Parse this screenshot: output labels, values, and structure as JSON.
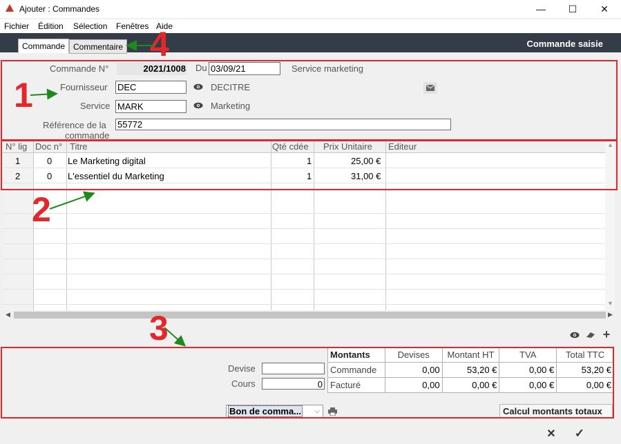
{
  "window": {
    "title": "Ajouter : Commandes",
    "minimize": "—",
    "maximize": "☐",
    "close": "✕"
  },
  "menu": [
    "Fichier",
    "Édition",
    "Sélection",
    "Fenêtres",
    "Aide"
  ],
  "tabs": [
    {
      "label": "Commande",
      "active": true
    },
    {
      "label": "Commentaire",
      "active": false
    }
  ],
  "status": "Commande saisie",
  "form": {
    "order_label": "Commande N°",
    "order_number": "2021/1008",
    "date_label": "Du",
    "date": "03/09/21",
    "service_text": "Service marketing",
    "supplier_label": "Fournisseur",
    "supplier_code": "DEC",
    "supplier_name": "DECITRE",
    "service_label": "Service",
    "service_code": "MARK",
    "service_name": "Marketing",
    "reference_label_1": "Référence de la",
    "reference_label_2": "commande",
    "reference": "55772"
  },
  "annotations": {
    "n1": "1",
    "n2": "2",
    "n3": "3",
    "n4": "4"
  },
  "grid": {
    "columns": [
      "N° lig",
      "Doc n°",
      "Titre",
      "Qté cdée",
      "Prix Unitaire",
      "Editeur"
    ],
    "rows": [
      [
        "1",
        "0",
        "Le Marketing digital",
        "1",
        "25,00 €",
        ""
      ],
      [
        "2",
        "0",
        "L'essentiel du Marketing",
        "1",
        "31,00 €",
        ""
      ]
    ]
  },
  "currency": {
    "devise_label": "Devise",
    "devise_value": "",
    "cours_label": "Cours",
    "cours_value": "0"
  },
  "amounts": {
    "headers": [
      "Montants",
      "Devises",
      "Montant HT",
      "TVA",
      "Total TTC"
    ],
    "rows": [
      [
        "Commande",
        "0,00",
        "53,20 €",
        "0,00 €",
        "53,20 €"
      ],
      [
        "Facturé",
        "0,00",
        "0,00 €",
        "0,00 €",
        "0,00 €"
      ]
    ]
  },
  "print_select": "Bon de comma...",
  "calc_button": "Calcul montants totaux",
  "footer": {
    "cancel": "✕",
    "ok": "✓"
  },
  "colors": {
    "accent_red": "#e3282b",
    "arrow_green": "#1e8a1e",
    "header_dark": "#333c47"
  }
}
